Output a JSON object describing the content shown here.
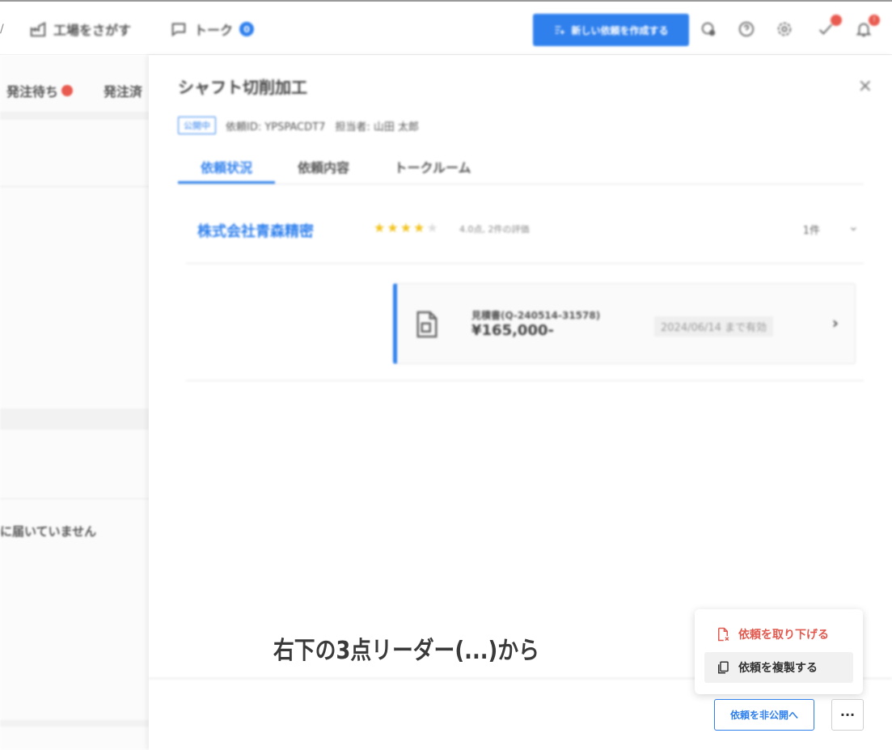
{
  "topbar": {
    "edge_mark": "/",
    "search_factory": "工場をさがす",
    "talk": "トーク",
    "talk_badge": "0",
    "new_request_button": "新しい依頼を作成する",
    "notification_badge": "!"
  },
  "left_list": {
    "tabs": [
      {
        "label": "発注待ち",
        "has_badge": true
      },
      {
        "label": "発注済",
        "has_badge": false
      }
    ],
    "empty_message": "に届いていません"
  },
  "drawer": {
    "title": "シャフト切削加工",
    "status_badge": "公開中",
    "request_id": "依頼ID: YPSPACDT7",
    "owner": "担当者: 山田 太郎",
    "close_glyph": "×",
    "tabs": [
      {
        "label": "依頼状況",
        "active": true
      },
      {
        "label": "依頼内容",
        "active": false
      },
      {
        "label": "トークルーム",
        "active": false
      }
    ],
    "vendor": {
      "name": "株式会社青森精密",
      "stars": "★★★★",
      "stars_dim": "★",
      "rating_score": 4,
      "rating_text": "4.0点, 2件の評価",
      "count": "1件",
      "chevron": "⌄"
    },
    "quote": {
      "label": "見積書(Q-240514-31578)",
      "amount": "¥165,000-",
      "valid_until": "2024/06/14 まで有効",
      "arrow": "›"
    }
  },
  "caption": "右下の3点リーダー(...)から",
  "menu": {
    "withdraw": "依頼を取り下げる",
    "duplicate": "依頼を複製する"
  },
  "footer": {
    "unpublish_button": "依頼を非公開へ",
    "more_button": "···"
  },
  "colors": {
    "accent": "#2f80ed",
    "danger": "#e05a4f",
    "star": "#f2c21b"
  }
}
